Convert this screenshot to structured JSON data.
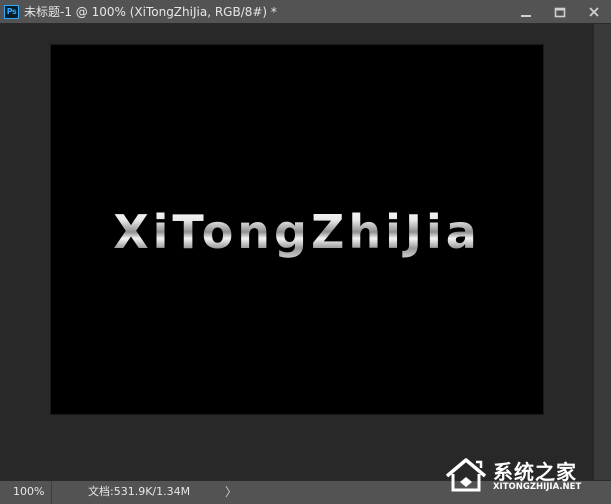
{
  "titlebar": {
    "app_icon_label": "Ps",
    "title": "未标题-1 @ 100% (XiTongZhiJia, RGB/8#) *",
    "controls": [
      "minimize-icon",
      "maximize-icon",
      "close-icon"
    ]
  },
  "canvas": {
    "background": "#000000",
    "text": "XiTongZhiJia"
  },
  "statusbar": {
    "zoom": "100%",
    "doc_info": "文档:531.9K/1.34M",
    "arrow": "〉"
  },
  "watermark": {
    "name": "系统之家",
    "url": "XITONGZHIJIA.NET"
  },
  "colors": {
    "accent": "#31a8ff",
    "chrome": "#535353",
    "workspace": "#282828",
    "text": "#e6e6e6"
  }
}
